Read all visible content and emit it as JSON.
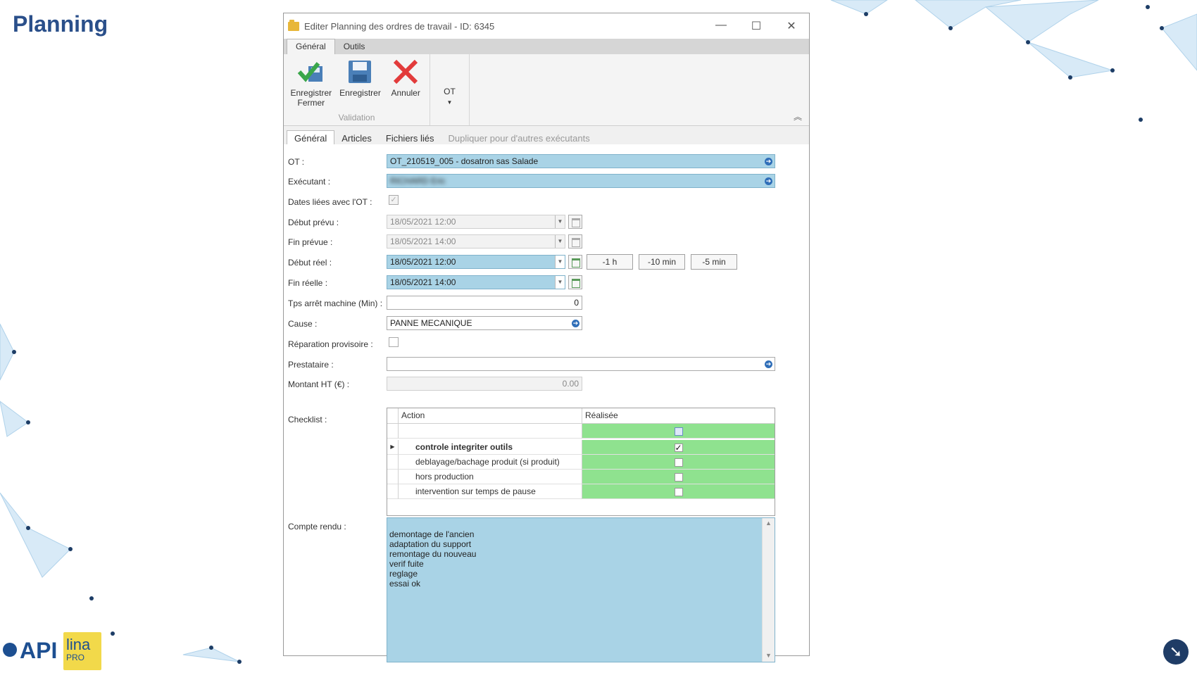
{
  "slide": {
    "title": "Planning"
  },
  "branding": {
    "logo_api": "API",
    "logo_lina": "lina",
    "logo_pro": "PRO"
  },
  "window": {
    "title": "Editer Planning des ordres de travail - ID: 6345",
    "controls": {
      "minimize": "—",
      "maximize": "☐",
      "close": "✕"
    }
  },
  "ribbon": {
    "tabs": [
      "Général",
      "Outils"
    ],
    "buttons": {
      "save_close": "Enregistrer Fermer",
      "save": "Enregistrer",
      "cancel": "Annuler",
      "ot": "OT"
    },
    "group_label": "Validation"
  },
  "form_tabs": [
    "Général",
    "Articles",
    "Fichiers liés",
    "Dupliquer pour d'autres exécutants"
  ],
  "form": {
    "labels": {
      "ot": "OT :",
      "executant": "Exécutant :",
      "dates_liees": "Dates liées avec l'OT :",
      "debut_prevu": "Début prévu :",
      "fin_prevue": "Fin prévue :",
      "debut_reel": "Début réel :",
      "fin_reelle": "Fin réelle :",
      "tps_arret": "Tps arrêt machine (Min) :",
      "cause": "Cause :",
      "reparation": "Réparation provisoire :",
      "prestataire": "Prestataire :",
      "montant": "Montant HT (€) :",
      "checklist": "Checklist :",
      "compte_rendu": "Compte rendu :"
    },
    "values": {
      "ot": "OT_210519_005 - dosatron sas Salade",
      "executant": "RICHARD Eric",
      "debut_prevu": "18/05/2021 12:00",
      "fin_prevue": "18/05/2021 14:00",
      "debut_reel": "18/05/2021 12:00",
      "fin_reelle": "18/05/2021 14:00",
      "tps_arret": "0",
      "cause": "PANNE MECANIQUE",
      "prestataire": "",
      "montant": "0.00"
    },
    "quick_buttons": [
      "-1 h",
      "-10 min",
      "-5 min"
    ],
    "checklist": {
      "columns": [
        "Action",
        "Réalisée"
      ],
      "rows": [
        {
          "action": "controle integriter outils",
          "done": "✓"
        },
        {
          "action": "deblayage/bachage produit (si produit)",
          "done": ""
        },
        {
          "action": "hors production",
          "done": ""
        },
        {
          "action": "intervention sur temps de pause",
          "done": ""
        }
      ]
    },
    "compte_rendu": "demontage de l'ancien\nadaptation du support\nremontage du nouveau\nverif fuite\nreglage\nessai ok"
  }
}
